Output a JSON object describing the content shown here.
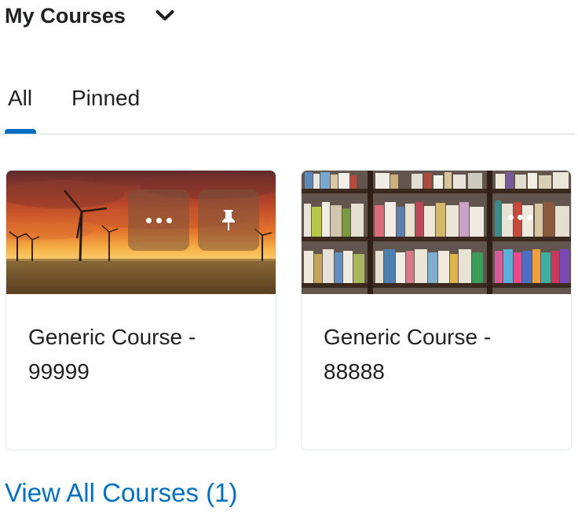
{
  "header": {
    "title": "My Courses",
    "dropdown_icon": "chevron-down-icon"
  },
  "tabs": [
    {
      "label": "All",
      "selected": true
    },
    {
      "label": "Pinned",
      "selected": false
    }
  ],
  "courses": [
    {
      "title_line1": "Generic Course -",
      "title_line2": "99999",
      "image": "wind-turbines-sunset",
      "actions": [
        "more-options-icon",
        "pin-icon"
      ]
    },
    {
      "title_line1": "Generic Course -",
      "title_line2": "88888",
      "image": "bookshelf",
      "actions": [
        "more-options-icon"
      ]
    }
  ],
  "footer": {
    "view_all_label": "View All Courses (1)"
  },
  "colors": {
    "accent": "#006fbf",
    "text": "#202122",
    "divider": "#d3d9e3"
  }
}
